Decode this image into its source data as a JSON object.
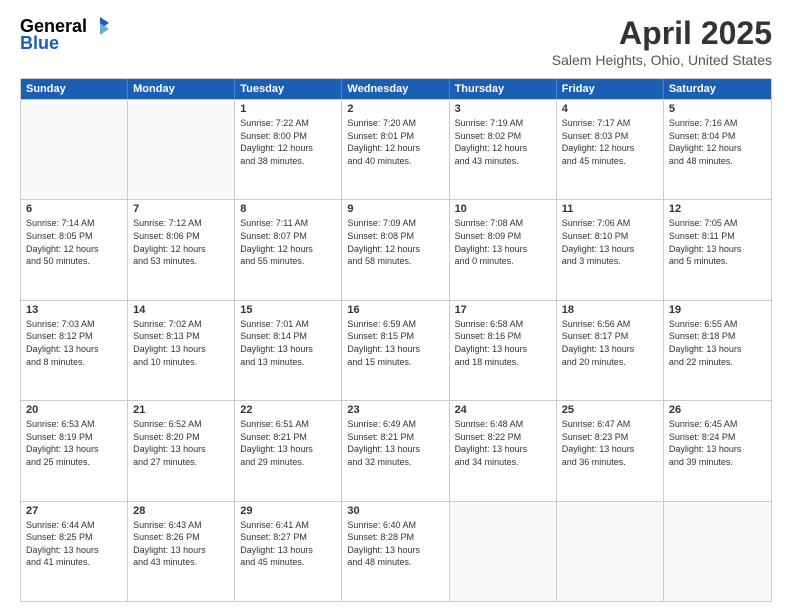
{
  "header": {
    "logo": {
      "general": "General",
      "blue": "Blue"
    },
    "title": "April 2025",
    "location": "Salem Heights, Ohio, United States"
  },
  "weekdays": [
    "Sunday",
    "Monday",
    "Tuesday",
    "Wednesday",
    "Thursday",
    "Friday",
    "Saturday"
  ],
  "weeks": [
    [
      {
        "day": "",
        "empty": true
      },
      {
        "day": "",
        "empty": true
      },
      {
        "day": "1",
        "line1": "Sunrise: 7:22 AM",
        "line2": "Sunset: 8:00 PM",
        "line3": "Daylight: 12 hours",
        "line4": "and 38 minutes."
      },
      {
        "day": "2",
        "line1": "Sunrise: 7:20 AM",
        "line2": "Sunset: 8:01 PM",
        "line3": "Daylight: 12 hours",
        "line4": "and 40 minutes."
      },
      {
        "day": "3",
        "line1": "Sunrise: 7:19 AM",
        "line2": "Sunset: 8:02 PM",
        "line3": "Daylight: 12 hours",
        "line4": "and 43 minutes."
      },
      {
        "day": "4",
        "line1": "Sunrise: 7:17 AM",
        "line2": "Sunset: 8:03 PM",
        "line3": "Daylight: 12 hours",
        "line4": "and 45 minutes."
      },
      {
        "day": "5",
        "line1": "Sunrise: 7:16 AM",
        "line2": "Sunset: 8:04 PM",
        "line3": "Daylight: 12 hours",
        "line4": "and 48 minutes."
      }
    ],
    [
      {
        "day": "6",
        "line1": "Sunrise: 7:14 AM",
        "line2": "Sunset: 8:05 PM",
        "line3": "Daylight: 12 hours",
        "line4": "and 50 minutes."
      },
      {
        "day": "7",
        "line1": "Sunrise: 7:12 AM",
        "line2": "Sunset: 8:06 PM",
        "line3": "Daylight: 12 hours",
        "line4": "and 53 minutes."
      },
      {
        "day": "8",
        "line1": "Sunrise: 7:11 AM",
        "line2": "Sunset: 8:07 PM",
        "line3": "Daylight: 12 hours",
        "line4": "and 55 minutes."
      },
      {
        "day": "9",
        "line1": "Sunrise: 7:09 AM",
        "line2": "Sunset: 8:08 PM",
        "line3": "Daylight: 12 hours",
        "line4": "and 58 minutes."
      },
      {
        "day": "10",
        "line1": "Sunrise: 7:08 AM",
        "line2": "Sunset: 8:09 PM",
        "line3": "Daylight: 13 hours",
        "line4": "and 0 minutes."
      },
      {
        "day": "11",
        "line1": "Sunrise: 7:06 AM",
        "line2": "Sunset: 8:10 PM",
        "line3": "Daylight: 13 hours",
        "line4": "and 3 minutes."
      },
      {
        "day": "12",
        "line1": "Sunrise: 7:05 AM",
        "line2": "Sunset: 8:11 PM",
        "line3": "Daylight: 13 hours",
        "line4": "and 5 minutes."
      }
    ],
    [
      {
        "day": "13",
        "line1": "Sunrise: 7:03 AM",
        "line2": "Sunset: 8:12 PM",
        "line3": "Daylight: 13 hours",
        "line4": "and 8 minutes."
      },
      {
        "day": "14",
        "line1": "Sunrise: 7:02 AM",
        "line2": "Sunset: 8:13 PM",
        "line3": "Daylight: 13 hours",
        "line4": "and 10 minutes."
      },
      {
        "day": "15",
        "line1": "Sunrise: 7:01 AM",
        "line2": "Sunset: 8:14 PM",
        "line3": "Daylight: 13 hours",
        "line4": "and 13 minutes."
      },
      {
        "day": "16",
        "line1": "Sunrise: 6:59 AM",
        "line2": "Sunset: 8:15 PM",
        "line3": "Daylight: 13 hours",
        "line4": "and 15 minutes."
      },
      {
        "day": "17",
        "line1": "Sunrise: 6:58 AM",
        "line2": "Sunset: 8:16 PM",
        "line3": "Daylight: 13 hours",
        "line4": "and 18 minutes."
      },
      {
        "day": "18",
        "line1": "Sunrise: 6:56 AM",
        "line2": "Sunset: 8:17 PM",
        "line3": "Daylight: 13 hours",
        "line4": "and 20 minutes."
      },
      {
        "day": "19",
        "line1": "Sunrise: 6:55 AM",
        "line2": "Sunset: 8:18 PM",
        "line3": "Daylight: 13 hours",
        "line4": "and 22 minutes."
      }
    ],
    [
      {
        "day": "20",
        "line1": "Sunrise: 6:53 AM",
        "line2": "Sunset: 8:19 PM",
        "line3": "Daylight: 13 hours",
        "line4": "and 25 minutes."
      },
      {
        "day": "21",
        "line1": "Sunrise: 6:52 AM",
        "line2": "Sunset: 8:20 PM",
        "line3": "Daylight: 13 hours",
        "line4": "and 27 minutes."
      },
      {
        "day": "22",
        "line1": "Sunrise: 6:51 AM",
        "line2": "Sunset: 8:21 PM",
        "line3": "Daylight: 13 hours",
        "line4": "and 29 minutes."
      },
      {
        "day": "23",
        "line1": "Sunrise: 6:49 AM",
        "line2": "Sunset: 8:21 PM",
        "line3": "Daylight: 13 hours",
        "line4": "and 32 minutes."
      },
      {
        "day": "24",
        "line1": "Sunrise: 6:48 AM",
        "line2": "Sunset: 8:22 PM",
        "line3": "Daylight: 13 hours",
        "line4": "and 34 minutes."
      },
      {
        "day": "25",
        "line1": "Sunrise: 6:47 AM",
        "line2": "Sunset: 8:23 PM",
        "line3": "Daylight: 13 hours",
        "line4": "and 36 minutes."
      },
      {
        "day": "26",
        "line1": "Sunrise: 6:45 AM",
        "line2": "Sunset: 8:24 PM",
        "line3": "Daylight: 13 hours",
        "line4": "and 39 minutes."
      }
    ],
    [
      {
        "day": "27",
        "line1": "Sunrise: 6:44 AM",
        "line2": "Sunset: 8:25 PM",
        "line3": "Daylight: 13 hours",
        "line4": "and 41 minutes."
      },
      {
        "day": "28",
        "line1": "Sunrise: 6:43 AM",
        "line2": "Sunset: 8:26 PM",
        "line3": "Daylight: 13 hours",
        "line4": "and 43 minutes."
      },
      {
        "day": "29",
        "line1": "Sunrise: 6:41 AM",
        "line2": "Sunset: 8:27 PM",
        "line3": "Daylight: 13 hours",
        "line4": "and 45 minutes."
      },
      {
        "day": "30",
        "line1": "Sunrise: 6:40 AM",
        "line2": "Sunset: 8:28 PM",
        "line3": "Daylight: 13 hours",
        "line4": "and 48 minutes."
      },
      {
        "day": "",
        "empty": true
      },
      {
        "day": "",
        "empty": true
      },
      {
        "day": "",
        "empty": true
      }
    ]
  ]
}
